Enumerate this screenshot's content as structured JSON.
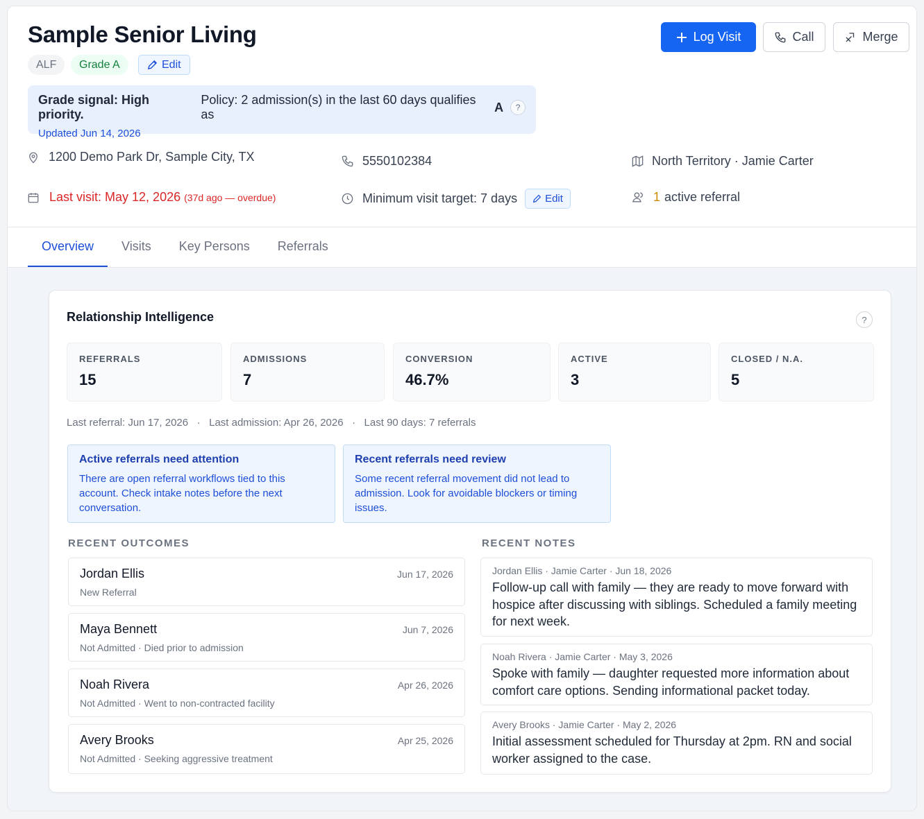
{
  "header": {
    "title": "Sample Senior Living",
    "chips": {
      "type": "ALF",
      "grade": "Grade A",
      "edit_label": "Edit"
    },
    "actions": {
      "log_visit": "Log Visit",
      "call": "Call",
      "merge": "Merge"
    }
  },
  "signal": {
    "bold": "Grade signal: High priority.",
    "policy": "Policy: 2 admission(s) in the last 60 days qualifies as",
    "grade_letter": "A",
    "help": "?",
    "updated": "Updated Jun 14, 2026"
  },
  "info": {
    "address": "1200 Demo Park Dr, Sample City, TX",
    "phone": "5550102384",
    "territory": "North Territory · Jamie Carter",
    "last_visit": "Last visit: May 12, 2026",
    "last_visit_note": "(37d ago — overdue)",
    "visit_target": "Minimum visit target: 7 days",
    "visit_target_edit": "Edit",
    "active_referral_count": "1",
    "active_referral_label": "active referral"
  },
  "tabs": [
    "Overview",
    "Visits",
    "Key Persons",
    "Referrals"
  ],
  "intel": {
    "title": "Relationship Intelligence",
    "help": "?",
    "stats": [
      {
        "label": "REFERRALS",
        "value": "15"
      },
      {
        "label": "ADMISSIONS",
        "value": "7"
      },
      {
        "label": "CONVERSION",
        "value": "46.7%"
      },
      {
        "label": "ACTIVE",
        "value": "3"
      },
      {
        "label": "CLOSED / N.A.",
        "value": "5"
      }
    ],
    "meta": "Last referral: Jun 17, 2026   ·   Last admission: Apr 26, 2026   ·   Last 90 days: 7 referrals",
    "alerts": [
      {
        "title": "Active referrals need attention",
        "text": "There are open referral workflows tied to this account. Check intake notes before the next conversation."
      },
      {
        "title": "Recent referrals need review",
        "text": "Some recent referral movement did not lead to admission. Look for avoidable blockers or timing issues."
      }
    ],
    "outcomes_label": "RECENT OUTCOMES",
    "notes_label": "RECENT NOTES",
    "outcomes": [
      {
        "name": "Jordan Ellis",
        "status": "New Referral",
        "date": "Jun 17, 2026"
      },
      {
        "name": "Maya Bennett",
        "status": "Not Admitted · Died prior to admission",
        "date": "Jun 7, 2026"
      },
      {
        "name": "Noah Rivera",
        "status": "Not Admitted · Went to non-contracted facility",
        "date": "Apr 26, 2026"
      },
      {
        "name": "Avery Brooks",
        "status": "Not Admitted · Seeking aggressive treatment",
        "date": "Apr 25, 2026"
      }
    ],
    "notes": [
      {
        "meta": "Jordan Ellis · Jamie Carter · Jun 18, 2026",
        "text": "Follow-up call with family — they are ready to move forward with hospice after discussing with siblings. Scheduled a family meeting for next week."
      },
      {
        "meta": "Noah Rivera · Jamie Carter · May 3, 2026",
        "text": "Spoke with family — daughter requested more information about comfort care options. Sending informational packet today."
      },
      {
        "meta": "Avery Brooks · Jamie Carter · May 2, 2026",
        "text": "Initial assessment scheduled for Thursday at 2pm. RN and social worker assigned to the case."
      }
    ]
  }
}
